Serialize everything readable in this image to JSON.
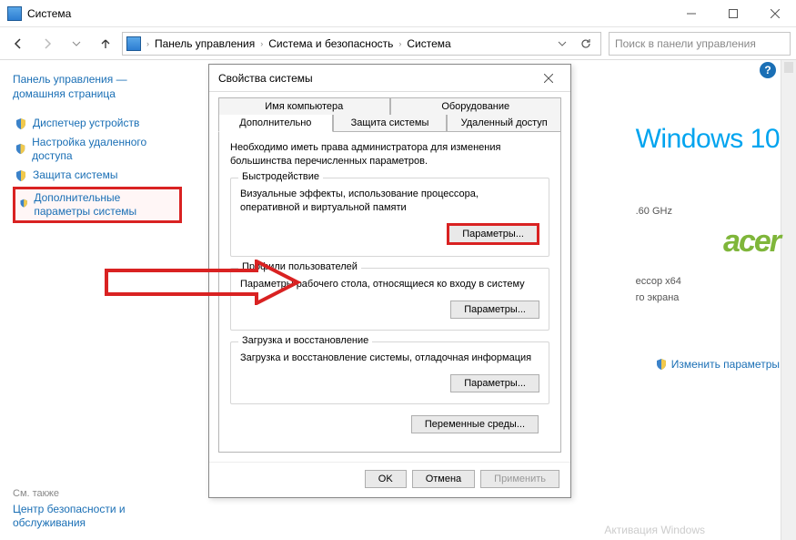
{
  "window": {
    "title": "Система",
    "breadcrumbs": [
      "Панель управления",
      "Система и безопасность",
      "Система"
    ],
    "search_placeholder": "Поиск в панели управления"
  },
  "sidebar": {
    "home": "Панель управления — домашняя страница",
    "items": [
      {
        "label": "Диспетчер устройств"
      },
      {
        "label": "Настройка удаленного доступа"
      },
      {
        "label": "Защита системы"
      },
      {
        "label": "Дополнительные параметры системы",
        "highlighted": true
      }
    ],
    "see_also_label": "См. также",
    "see_also_link": "Центр безопасности и обслуживания"
  },
  "main": {
    "windows_brand": "Windows 10",
    "spec_cpu_speed": ".60 GHz",
    "spec_arch": "ессор x64",
    "spec_screen": "го экрана",
    "acer": "acer",
    "change_link": "Изменить параметры",
    "activation_hint": "Активация Windows"
  },
  "dialog": {
    "title": "Свойства системы",
    "tabs_back": [
      "Имя компьютера",
      "Оборудование"
    ],
    "tabs_front": [
      "Дополнительно",
      "Защита системы",
      "Удаленный доступ"
    ],
    "active_tab": "Дополнительно",
    "admin_note": "Необходимо иметь права администратора для изменения большинства перечисленных параметров.",
    "groups": [
      {
        "legend": "Быстродействие",
        "text": "Визуальные эффекты, использование процессора, оперативной и виртуальной памяти",
        "button": "Параметры...",
        "highlighted": true
      },
      {
        "legend": "Профили пользователей",
        "text": "Параметры рабочего стола, относящиеся ко входу в систему",
        "button": "Параметры..."
      },
      {
        "legend": "Загрузка и восстановление",
        "text": "Загрузка и восстановление системы, отладочная информация",
        "button": "Параметры..."
      }
    ],
    "env_button": "Переменные среды...",
    "ok": "OK",
    "cancel": "Отмена",
    "apply": "Применить"
  }
}
